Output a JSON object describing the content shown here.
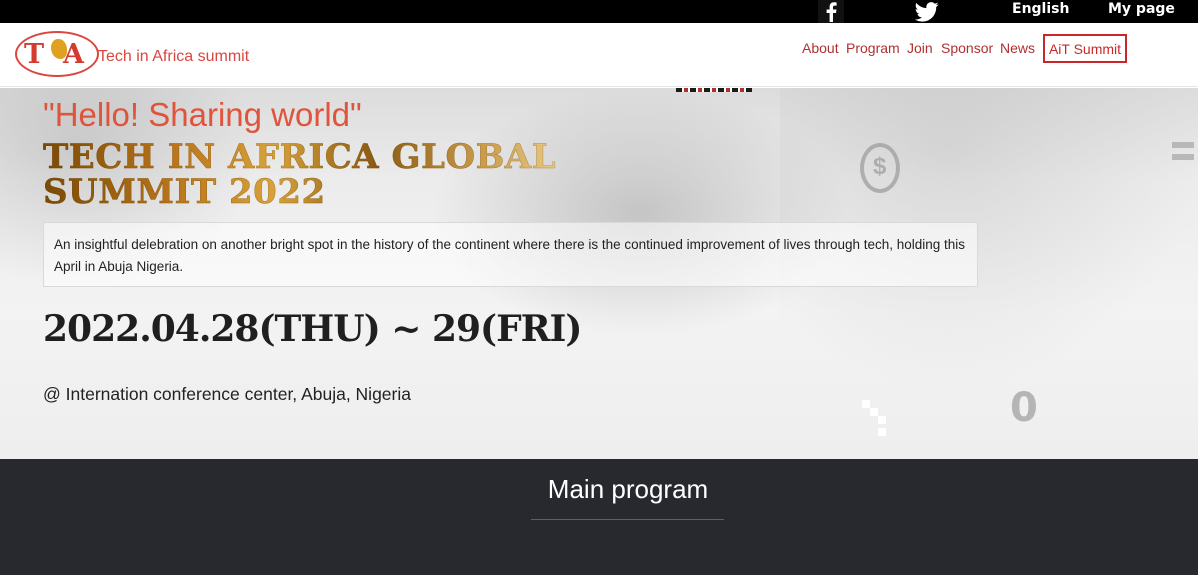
{
  "topbar": {
    "facebook_icon": "facebook-icon",
    "twitter_icon": "twitter-icon",
    "language": "English",
    "my_page": "My page"
  },
  "header": {
    "logo_text": "T A",
    "logo_t": "T",
    "logo_a": "A",
    "brand": "Tech in Africa summit",
    "nav": [
      "About",
      "Program",
      "Join",
      "Sponsor",
      "News"
    ],
    "cta": "AiT Summit"
  },
  "hero": {
    "greeting": "\"Hello! Sharing world\"",
    "title_line1": "TECH IN AFRICA GLOBAL",
    "title_line2": "SUMMIT 2022",
    "description": "An insightful delebration on another bright spot in the history of the continent where there is the continued improvement of lives through tech, holding this April in Abuja Nigeria.",
    "date": "2022.04.28(THU) ~ 29(FRI)",
    "venue": "@ Internation conference center, Abuja, Nigeria"
  },
  "program": {
    "heading": "Main program"
  },
  "colors": {
    "accent": "#d9473f",
    "nav_text": "#b03030",
    "cta_border": "#c8282a",
    "dark_section": "#27292e",
    "topbar": "#000000"
  }
}
